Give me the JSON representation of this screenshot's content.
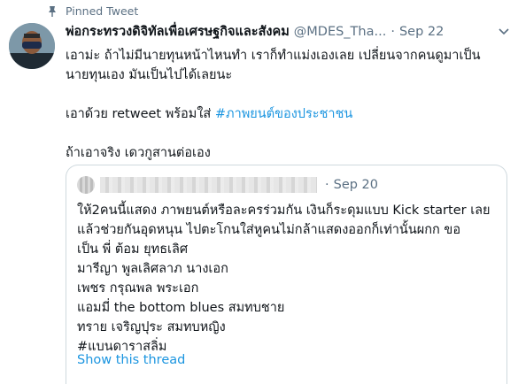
{
  "pinned": {
    "label": "Pinned Tweet"
  },
  "tweet": {
    "display_name": "พ่อกระทรวงดิจิทัลเพื่อเศรษฐกิจและสังคม",
    "handle": "@MDES_Tha...",
    "separator": "·",
    "date": "Sep 22",
    "lines": [
      "เอาม่ะ ถ้าไม่มีนายทุนหน้าไหนทำ เราก็ทำแม่งเองเลย เปลี่ยนจากคนดูมาเป็น",
      "นายทุนเอง มันเป็นไปได้เลยนะ"
    ],
    "retweet_prefix": "เอาด้วย retweet พร้อมใส่ ",
    "hashtag": "#ภาพยนต์ของประชาชน",
    "closing": "ถ้าเอาจริง เดวกูสานต่อเอง"
  },
  "quote": {
    "separator": "·",
    "date": "Sep 20",
    "lines": [
      "ให้2คนนี้แสดง ภาพยนต์หรือละครร่วมกัน เงินก็ระดุมแบบ Kick starter เลย",
      "แล้วช่วยกันอุดหนุน ไปตะโกนใส่หูคนไม่กล้าแสดงออกก็เท่านั้นผกก ขอ",
      "เป็น พี่ ต้อม ยุทธเลิศ",
      "มารีญา พูลเลิศลาภ นางเอก",
      "เพชร กรุณพล  พระเอก",
      "แอมมี่ the bottom blues สมทบชาย",
      "ทราย เจริญปุระ สมทบหญิง",
      " #แบนดาราสลิ่ม"
    ],
    "show_thread": "Show this thread"
  }
}
